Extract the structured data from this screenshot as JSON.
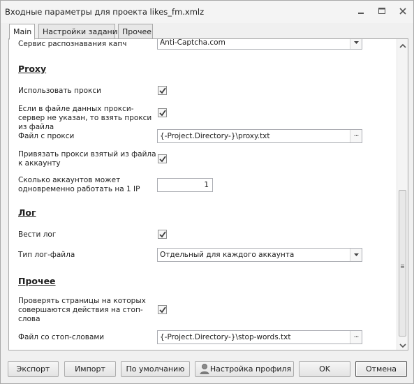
{
  "window": {
    "title": "Входные параметры для проекта likes_fm.xmlz"
  },
  "tabs": [
    {
      "label": "Main",
      "active": true
    },
    {
      "label": "Настройки заданий",
      "active": false
    },
    {
      "label": "Прочее",
      "active": false
    }
  ],
  "settings": {
    "captcha_service": {
      "label": "Сервис распознавания капч",
      "value": "Anti-Captcha.com"
    },
    "proxy_section": "Proxy",
    "use_proxy": {
      "label": "Использовать прокси",
      "checked": true
    },
    "proxy_from_file": {
      "label": "Если в файле данных прокси-сервер не указан, то взять прокси из файла",
      "checked": true
    },
    "proxy_file": {
      "label": "Файл с прокси",
      "value": "{-Project.Directory-}\\proxy.txt"
    },
    "bind_proxy": {
      "label": "Привязать прокси взятый из файла к аккаунту",
      "checked": true
    },
    "accounts_per_ip": {
      "label": "Сколько аккаунтов может одновременно работать на 1 IP",
      "value": "1"
    },
    "log_section": "Лог",
    "keep_log": {
      "label": "Вести лог",
      "checked": true
    },
    "log_type": {
      "label": "Тип лог-файла",
      "value": "Отдельный для каждого аккаунта"
    },
    "other_section": "Прочее",
    "check_stopwords": {
      "label": "Проверять страницы на которых совершаются действия на стоп-слова",
      "checked": true
    },
    "stopwords_file": {
      "label": "Файл со стоп-словами",
      "value": "{-Project.Directory-}\\stop-words.txt"
    }
  },
  "buttons": {
    "export": "Экспорт",
    "import": "Импорт",
    "default": "По умолчанию",
    "profile": "Настройка профиля",
    "ok": "OK",
    "cancel": "Отмена"
  },
  "icons": {
    "minimize": "minimize-icon",
    "maximize": "maximize-icon",
    "close": "close-icon",
    "profile": "user-profile-icon"
  },
  "colors": {
    "border": "#a9a9a9",
    "panel": "#ffffff",
    "window": "#f0f0f0"
  }
}
